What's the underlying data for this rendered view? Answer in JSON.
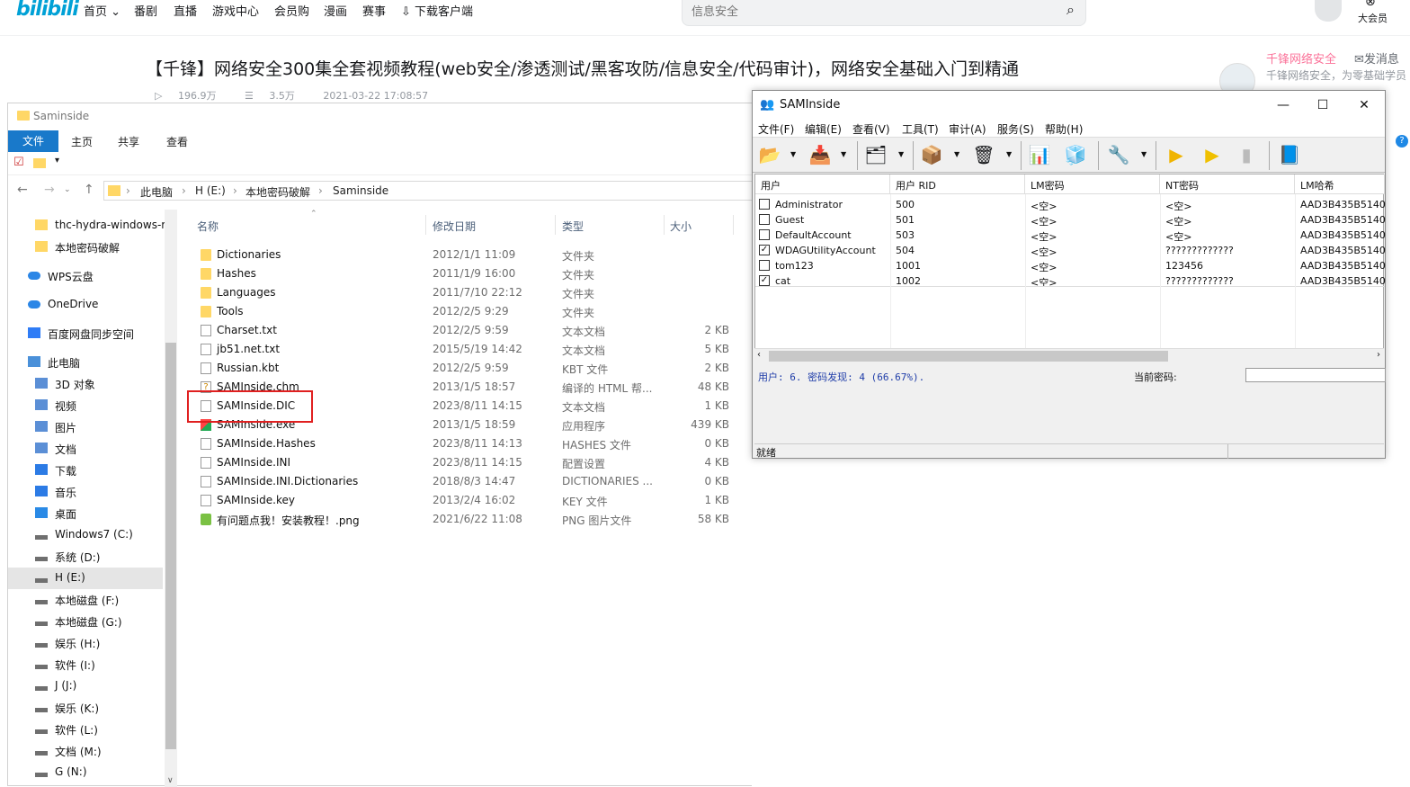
{
  "bili": {
    "nav": [
      "首页",
      "番剧",
      "直播",
      "游戏中心",
      "会员购",
      "漫画",
      "赛事",
      "下载客户端"
    ],
    "search_placeholder": "信息安全",
    "video_title": "【千锋】网络安全300集全套视频教程(web安全/渗透测试/黑客攻防/信息安全/代码审计)，网络安全基础入门到精通",
    "views": "196.9万",
    "danmaku": "3.5万",
    "pubdate": "2021-03-22 17:08:57",
    "up_name": "千锋网络安全",
    "send_msg": "发消息",
    "up_desc": "千锋网络安全，为零基础学员",
    "vip_label": "大会员"
  },
  "explorer": {
    "title": "Saminside",
    "tabs": [
      "文件",
      "主页",
      "共享",
      "查看"
    ],
    "breadcrumb": [
      "此电脑",
      "H (E:)",
      "本地密码破解",
      "Saminside"
    ],
    "nav_items": [
      {
        "label": "thc-hydra-windows-r",
        "type": "folder"
      },
      {
        "label": "本地密码破解",
        "type": "folder"
      },
      {
        "label": "WPS云盘",
        "type": "cloud"
      },
      {
        "label": "OneDrive",
        "type": "cloud"
      },
      {
        "label": "百度网盘同步空间",
        "type": "baidu"
      },
      {
        "label": "此电脑",
        "type": "pc"
      },
      {
        "label": "3D 对象",
        "type": "lib"
      },
      {
        "label": "视频",
        "type": "lib"
      },
      {
        "label": "图片",
        "type": "lib"
      },
      {
        "label": "文档",
        "type": "lib"
      },
      {
        "label": "下载",
        "type": "download"
      },
      {
        "label": "音乐",
        "type": "music"
      },
      {
        "label": "桌面",
        "type": "desktop"
      },
      {
        "label": "Windows7 (C:)",
        "type": "drive"
      },
      {
        "label": "系统 (D:)",
        "type": "drive"
      },
      {
        "label": "H (E:)",
        "type": "drive"
      },
      {
        "label": "本地磁盘 (F:)",
        "type": "drive"
      },
      {
        "label": "本地磁盘 (G:)",
        "type": "drive"
      },
      {
        "label": "娱乐 (H:)",
        "type": "drive"
      },
      {
        "label": "软件 (I:)",
        "type": "drive"
      },
      {
        "label": "J (J:)",
        "type": "drive"
      },
      {
        "label": "娱乐 (K:)",
        "type": "drive"
      },
      {
        "label": "软件 (L:)",
        "type": "drive"
      },
      {
        "label": "文档 (M:)",
        "type": "drive"
      },
      {
        "label": "G (N:)",
        "type": "drive"
      }
    ],
    "columns": [
      "名称",
      "修改日期",
      "类型",
      "大小"
    ],
    "files": [
      {
        "name": "Dictionaries",
        "date": "2012/1/1 11:09",
        "type": "文件夹",
        "size": "",
        "icon": "folder"
      },
      {
        "name": "Hashes",
        "date": "2011/1/9 16:00",
        "type": "文件夹",
        "size": "",
        "icon": "folder"
      },
      {
        "name": "Languages",
        "date": "2011/7/10 22:12",
        "type": "文件夹",
        "size": "",
        "icon": "folder"
      },
      {
        "name": "Tools",
        "date": "2012/2/5 9:29",
        "type": "文件夹",
        "size": "",
        "icon": "folder"
      },
      {
        "name": "Charset.txt",
        "date": "2012/2/5 9:59",
        "type": "文本文档",
        "size": "2 KB",
        "icon": "doc"
      },
      {
        "name": "jb51.net.txt",
        "date": "2015/5/19 14:42",
        "type": "文本文档",
        "size": "5 KB",
        "icon": "doc"
      },
      {
        "name": "Russian.kbt",
        "date": "2012/2/5 9:59",
        "type": "KBT 文件",
        "size": "2 KB",
        "icon": "doc"
      },
      {
        "name": "SAMInside.chm",
        "date": "2013/1/5 18:57",
        "type": "编译的 HTML 帮...",
        "size": "48 KB",
        "icon": "chm"
      },
      {
        "name": "SAMInside.DIC",
        "date": "2023/8/11 14:15",
        "type": "文本文档",
        "size": "1 KB",
        "icon": "doc"
      },
      {
        "name": "SAMInside.exe",
        "date": "2013/1/5 18:59",
        "type": "应用程序",
        "size": "439 KB",
        "icon": "exe"
      },
      {
        "name": "SAMInside.Hashes",
        "date": "2023/8/11 14:13",
        "type": "HASHES 文件",
        "size": "0 KB",
        "icon": "doc"
      },
      {
        "name": "SAMInside.INI",
        "date": "2023/8/11 14:15",
        "type": "配置设置",
        "size": "4 KB",
        "icon": "doc"
      },
      {
        "name": "SAMInside.INI.Dictionaries",
        "date": "2018/8/3 14:47",
        "type": "DICTIONARIES ...",
        "size": "0 KB",
        "icon": "doc"
      },
      {
        "name": "SAMInside.key",
        "date": "2013/2/4 16:02",
        "type": "KEY 文件",
        "size": "1 KB",
        "icon": "doc"
      },
      {
        "name": "有问题点我！安装教程！.png",
        "date": "2021/6/22 11:08",
        "type": "PNG 图片文件",
        "size": "58 KB",
        "icon": "png"
      }
    ]
  },
  "saminside": {
    "title": "SAMInside",
    "menu": [
      "文件(F)",
      "编辑(E)",
      "查看(V)",
      "工具(T)",
      "审计(A)",
      "服务(S)",
      "帮助(H)"
    ],
    "columns": [
      "用户",
      "用户 RID",
      "LM密码",
      "NT密码",
      "LM哈希"
    ],
    "rows": [
      {
        "checked": false,
        "user": "Administrator",
        "rid": "500",
        "lm": "<空>",
        "nt": "<空>",
        "lmhash": "AAD3B435B5140"
      },
      {
        "checked": false,
        "user": "Guest",
        "rid": "501",
        "lm": "<空>",
        "nt": "<空>",
        "lmhash": "AAD3B435B5140"
      },
      {
        "checked": false,
        "user": "DefaultAccount",
        "rid": "503",
        "lm": "<空>",
        "nt": "<空>",
        "lmhash": "AAD3B435B5140"
      },
      {
        "checked": true,
        "user": "WDAGUtilityAccount",
        "rid": "504",
        "lm": "<空>",
        "nt": "?????????????",
        "lmhash": "AAD3B435B5140"
      },
      {
        "checked": false,
        "user": "tom123",
        "rid": "1001",
        "lm": "<空>",
        "nt": "123456",
        "lmhash": "AAD3B435B5140"
      },
      {
        "checked": true,
        "user": "cat",
        "rid": "1002",
        "lm": "<空>",
        "nt": "?????????????",
        "lmhash": "AAD3B435B5140"
      }
    ],
    "stats": "用户: 6. 密码发现: 4 (66.67%).",
    "current_password_label": "当前密码:",
    "status": "就绪"
  }
}
